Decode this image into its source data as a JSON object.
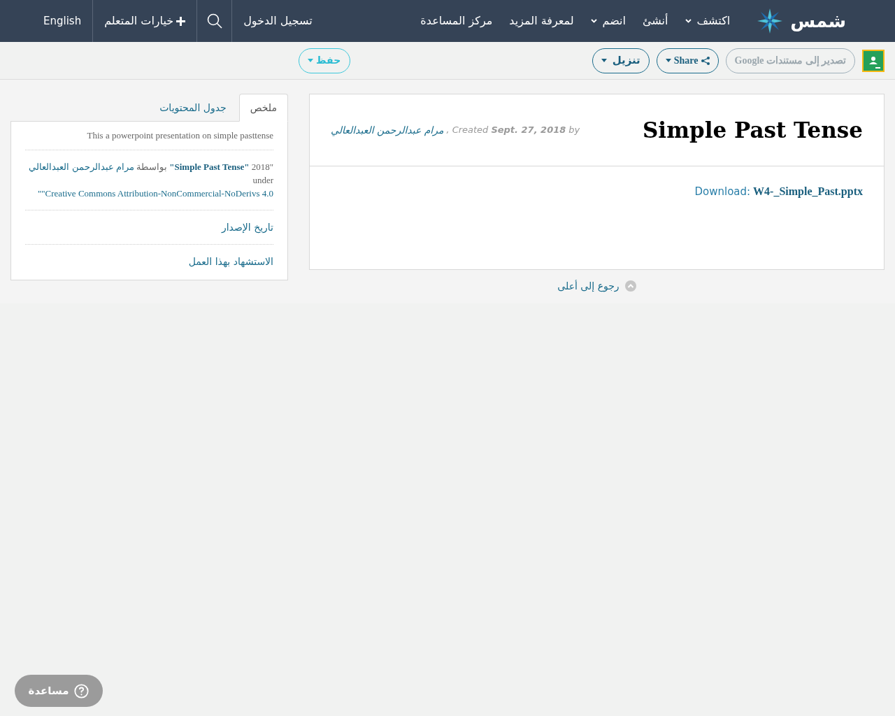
{
  "header": {
    "logo": "شمس",
    "nav": [
      {
        "label": "اكتشف",
        "dropdown": true
      },
      {
        "label": "أنشئ",
        "dropdown": false
      },
      {
        "label": "انضم",
        "dropdown": true
      },
      {
        "label": "لمعرفة المزيد",
        "dropdown": false
      },
      {
        "label": "مركز المساعدة",
        "dropdown": false
      }
    ],
    "login": "تسجيل الدخول",
    "learner_options": "خيارات المتعلم",
    "language": "English"
  },
  "toolbar": {
    "export": "تصدير إلى مستندات Google",
    "share": "Share",
    "download": "تنزيل",
    "save": "حفظ"
  },
  "resource": {
    "title": "Simple Past Tense",
    "by": "by",
    "date": "Sept. 27, 2018",
    "created": "Created",
    "comma": ",",
    "author": "مرام عبدالرحمن العبدالعالي",
    "download_label": "Download:",
    "file": "W4-_Simple_Past.pptx",
    "back_to_top": "رجوع إلى أعلى"
  },
  "side": {
    "tabs": [
      {
        "label": "ملخص",
        "selected": true
      },
      {
        "label": "جدول المحتويات",
        "selected": false
      }
    ],
    "summary": "This a powerpoint presentation on simple pasttense",
    "attribution": [
      {
        "kind": "text",
        "text": "\"2018"
      },
      {
        "kind": "strong-link",
        "text": "\"Simple Past Tense\""
      },
      {
        "kind": "text",
        "text": "بواسطة"
      },
      {
        "kind": "link",
        "text": "مرام عبدالرحمن العبدالعالي"
      },
      {
        "kind": "text",
        "text": "under"
      },
      {
        "kind": "link",
        "text": "\"Creative Commons Attribution-NonCommercial-NoDerivs 4.0\""
      }
    ],
    "links": [
      "تاريخ الإصدار",
      "الاستشهاد بهذا العمل"
    ]
  },
  "help_button": "مساعدة"
}
